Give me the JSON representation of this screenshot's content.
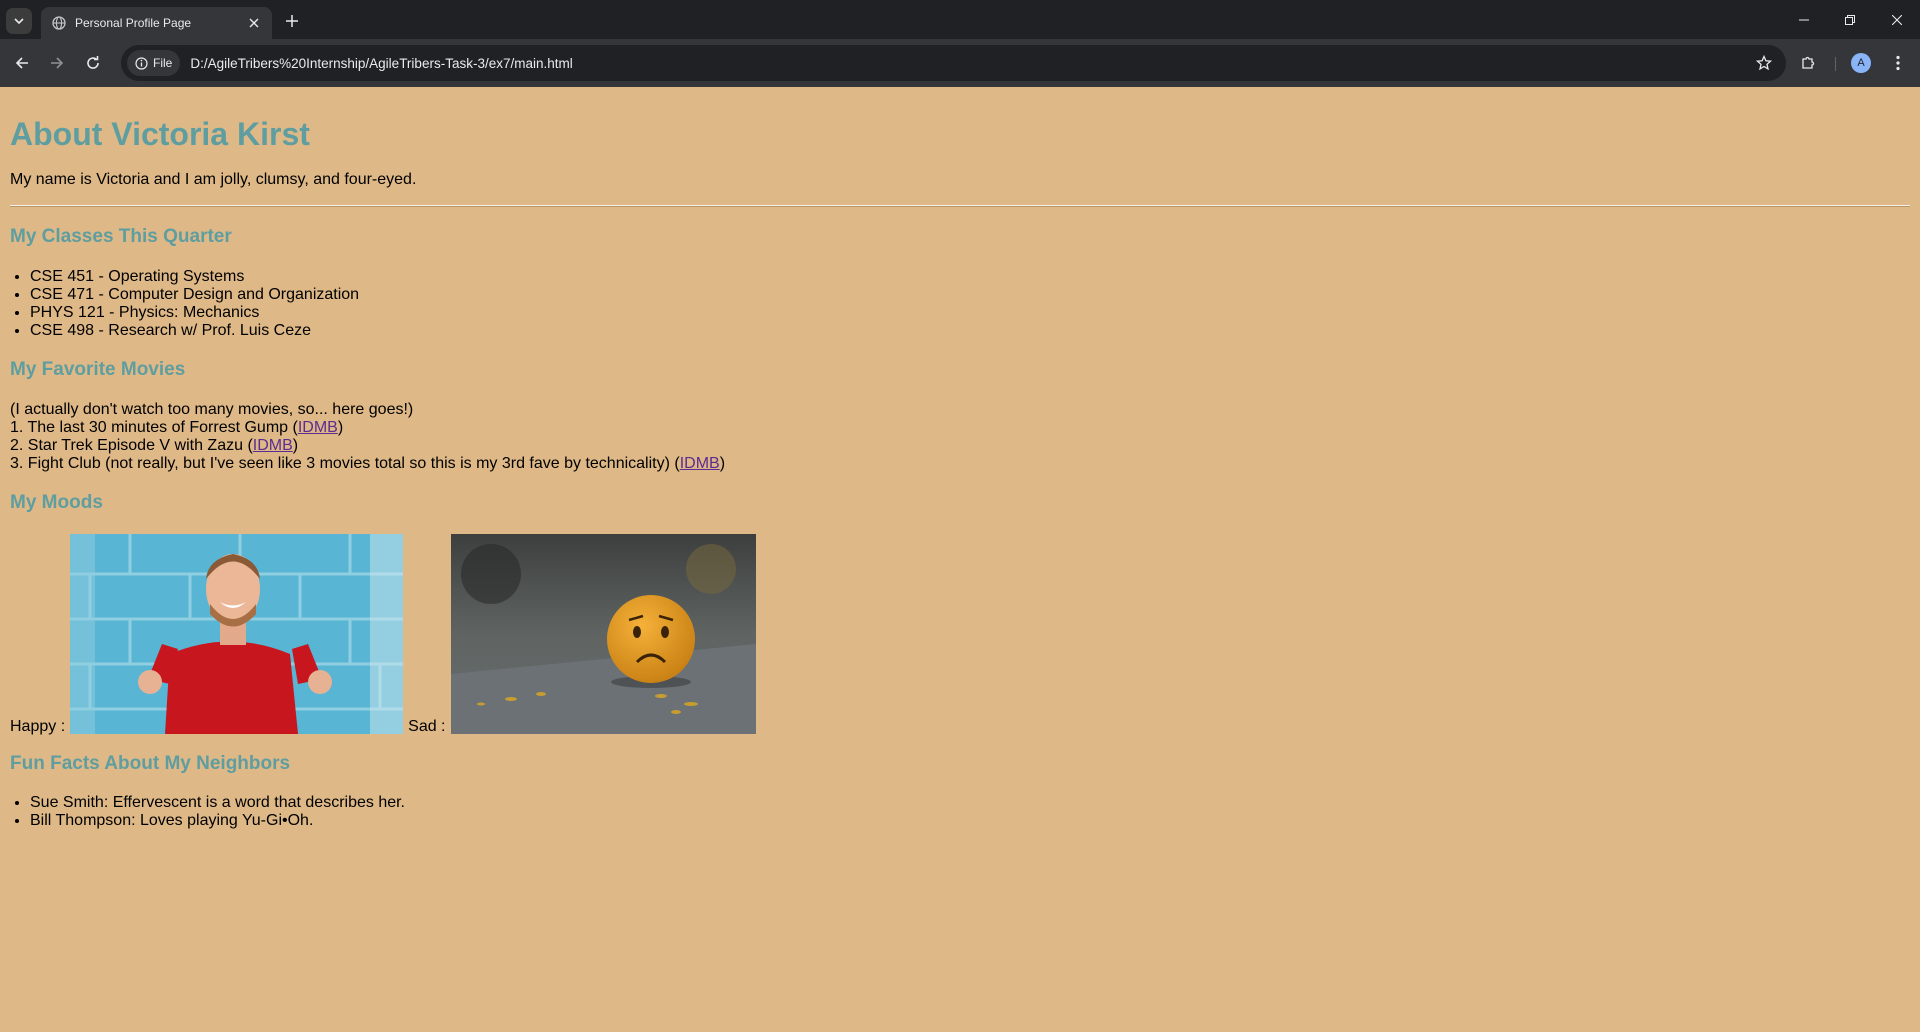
{
  "browser": {
    "tab_title": "Personal Profile Page",
    "chip_label": "File",
    "url": "D:/AgileTribers%20Internship/AgileTribers-Task-3/ex7/main.html",
    "avatar_letter": "A"
  },
  "page": {
    "title": "About Victoria Kirst",
    "intro": "My name is Victoria and I am jolly, clumsy, and four-eyed.",
    "classes_heading": "My Classes This Quarter",
    "classes": [
      "CSE 451 - Operating Systems",
      "CSE 471 - Computer Design and Organization",
      "PHYS 121 - Physics: Mechanics",
      "CSE 498 - Research w/ Prof. Luis Ceze"
    ],
    "movies_heading": "My Favorite Movies",
    "movies_intro": "(I actually don't watch too many movies, so... here goes!)",
    "movies": [
      {
        "num": "1.",
        "text": "The last 30 minutes of Forrest Gump (",
        "link": "IDMB",
        "close": ")"
      },
      {
        "num": "2.",
        "text": "Star Trek Episode V with Zazu (",
        "link": "IDMB",
        "close": ")"
      },
      {
        "num": "3.",
        "text": "Fight Club (not really, but I've seen like 3 movies total so this is my 3rd fave by technicality) (",
        "link": "IDMB",
        "close": ")"
      }
    ],
    "moods_heading": "My Moods",
    "happy_label": "Happy :",
    "sad_label": "Sad :",
    "neighbors_heading": "Fun Facts About My Neighbors",
    "neighbors": [
      "Sue Smith: Effervescent is a word that describes her.",
      "Bill Thompson: Loves playing Yu-Gi•Oh."
    ]
  }
}
